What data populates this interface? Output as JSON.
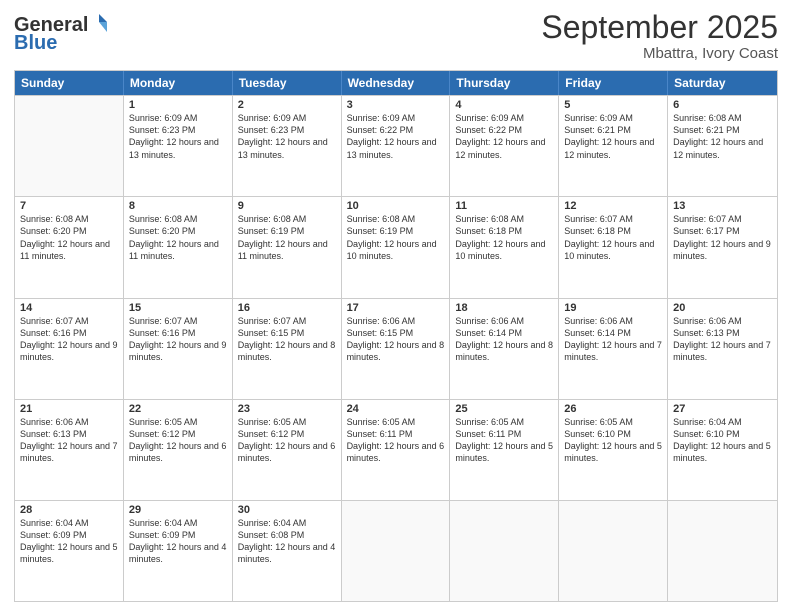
{
  "logo": {
    "general": "General",
    "blue": "Blue"
  },
  "title": "September 2025",
  "subtitle": "Mbattra, Ivory Coast",
  "header_days": [
    "Sunday",
    "Monday",
    "Tuesday",
    "Wednesday",
    "Thursday",
    "Friday",
    "Saturday"
  ],
  "weeks": [
    [
      {
        "day": "",
        "sunrise": "",
        "sunset": "",
        "daylight": ""
      },
      {
        "day": "1",
        "sunrise": "Sunrise: 6:09 AM",
        "sunset": "Sunset: 6:23 PM",
        "daylight": "Daylight: 12 hours and 13 minutes."
      },
      {
        "day": "2",
        "sunrise": "Sunrise: 6:09 AM",
        "sunset": "Sunset: 6:23 PM",
        "daylight": "Daylight: 12 hours and 13 minutes."
      },
      {
        "day": "3",
        "sunrise": "Sunrise: 6:09 AM",
        "sunset": "Sunset: 6:22 PM",
        "daylight": "Daylight: 12 hours and 13 minutes."
      },
      {
        "day": "4",
        "sunrise": "Sunrise: 6:09 AM",
        "sunset": "Sunset: 6:22 PM",
        "daylight": "Daylight: 12 hours and 12 minutes."
      },
      {
        "day": "5",
        "sunrise": "Sunrise: 6:09 AM",
        "sunset": "Sunset: 6:21 PM",
        "daylight": "Daylight: 12 hours and 12 minutes."
      },
      {
        "day": "6",
        "sunrise": "Sunrise: 6:08 AM",
        "sunset": "Sunset: 6:21 PM",
        "daylight": "Daylight: 12 hours and 12 minutes."
      }
    ],
    [
      {
        "day": "7",
        "sunrise": "Sunrise: 6:08 AM",
        "sunset": "Sunset: 6:20 PM",
        "daylight": "Daylight: 12 hours and 11 minutes."
      },
      {
        "day": "8",
        "sunrise": "Sunrise: 6:08 AM",
        "sunset": "Sunset: 6:20 PM",
        "daylight": "Daylight: 12 hours and 11 minutes."
      },
      {
        "day": "9",
        "sunrise": "Sunrise: 6:08 AM",
        "sunset": "Sunset: 6:19 PM",
        "daylight": "Daylight: 12 hours and 11 minutes."
      },
      {
        "day": "10",
        "sunrise": "Sunrise: 6:08 AM",
        "sunset": "Sunset: 6:19 PM",
        "daylight": "Daylight: 12 hours and 10 minutes."
      },
      {
        "day": "11",
        "sunrise": "Sunrise: 6:08 AM",
        "sunset": "Sunset: 6:18 PM",
        "daylight": "Daylight: 12 hours and 10 minutes."
      },
      {
        "day": "12",
        "sunrise": "Sunrise: 6:07 AM",
        "sunset": "Sunset: 6:18 PM",
        "daylight": "Daylight: 12 hours and 10 minutes."
      },
      {
        "day": "13",
        "sunrise": "Sunrise: 6:07 AM",
        "sunset": "Sunset: 6:17 PM",
        "daylight": "Daylight: 12 hours and 9 minutes."
      }
    ],
    [
      {
        "day": "14",
        "sunrise": "Sunrise: 6:07 AM",
        "sunset": "Sunset: 6:16 PM",
        "daylight": "Daylight: 12 hours and 9 minutes."
      },
      {
        "day": "15",
        "sunrise": "Sunrise: 6:07 AM",
        "sunset": "Sunset: 6:16 PM",
        "daylight": "Daylight: 12 hours and 9 minutes."
      },
      {
        "day": "16",
        "sunrise": "Sunrise: 6:07 AM",
        "sunset": "Sunset: 6:15 PM",
        "daylight": "Daylight: 12 hours and 8 minutes."
      },
      {
        "day": "17",
        "sunrise": "Sunrise: 6:06 AM",
        "sunset": "Sunset: 6:15 PM",
        "daylight": "Daylight: 12 hours and 8 minutes."
      },
      {
        "day": "18",
        "sunrise": "Sunrise: 6:06 AM",
        "sunset": "Sunset: 6:14 PM",
        "daylight": "Daylight: 12 hours and 8 minutes."
      },
      {
        "day": "19",
        "sunrise": "Sunrise: 6:06 AM",
        "sunset": "Sunset: 6:14 PM",
        "daylight": "Daylight: 12 hours and 7 minutes."
      },
      {
        "day": "20",
        "sunrise": "Sunrise: 6:06 AM",
        "sunset": "Sunset: 6:13 PM",
        "daylight": "Daylight: 12 hours and 7 minutes."
      }
    ],
    [
      {
        "day": "21",
        "sunrise": "Sunrise: 6:06 AM",
        "sunset": "Sunset: 6:13 PM",
        "daylight": "Daylight: 12 hours and 7 minutes."
      },
      {
        "day": "22",
        "sunrise": "Sunrise: 6:05 AM",
        "sunset": "Sunset: 6:12 PM",
        "daylight": "Daylight: 12 hours and 6 minutes."
      },
      {
        "day": "23",
        "sunrise": "Sunrise: 6:05 AM",
        "sunset": "Sunset: 6:12 PM",
        "daylight": "Daylight: 12 hours and 6 minutes."
      },
      {
        "day": "24",
        "sunrise": "Sunrise: 6:05 AM",
        "sunset": "Sunset: 6:11 PM",
        "daylight": "Daylight: 12 hours and 6 minutes."
      },
      {
        "day": "25",
        "sunrise": "Sunrise: 6:05 AM",
        "sunset": "Sunset: 6:11 PM",
        "daylight": "Daylight: 12 hours and 5 minutes."
      },
      {
        "day": "26",
        "sunrise": "Sunrise: 6:05 AM",
        "sunset": "Sunset: 6:10 PM",
        "daylight": "Daylight: 12 hours and 5 minutes."
      },
      {
        "day": "27",
        "sunrise": "Sunrise: 6:04 AM",
        "sunset": "Sunset: 6:10 PM",
        "daylight": "Daylight: 12 hours and 5 minutes."
      }
    ],
    [
      {
        "day": "28",
        "sunrise": "Sunrise: 6:04 AM",
        "sunset": "Sunset: 6:09 PM",
        "daylight": "Daylight: 12 hours and 5 minutes."
      },
      {
        "day": "29",
        "sunrise": "Sunrise: 6:04 AM",
        "sunset": "Sunset: 6:09 PM",
        "daylight": "Daylight: 12 hours and 4 minutes."
      },
      {
        "day": "30",
        "sunrise": "Sunrise: 6:04 AM",
        "sunset": "Sunset: 6:08 PM",
        "daylight": "Daylight: 12 hours and 4 minutes."
      },
      {
        "day": "",
        "sunrise": "",
        "sunset": "",
        "daylight": ""
      },
      {
        "day": "",
        "sunrise": "",
        "sunset": "",
        "daylight": ""
      },
      {
        "day": "",
        "sunrise": "",
        "sunset": "",
        "daylight": ""
      },
      {
        "day": "",
        "sunrise": "",
        "sunset": "",
        "daylight": ""
      }
    ]
  ]
}
